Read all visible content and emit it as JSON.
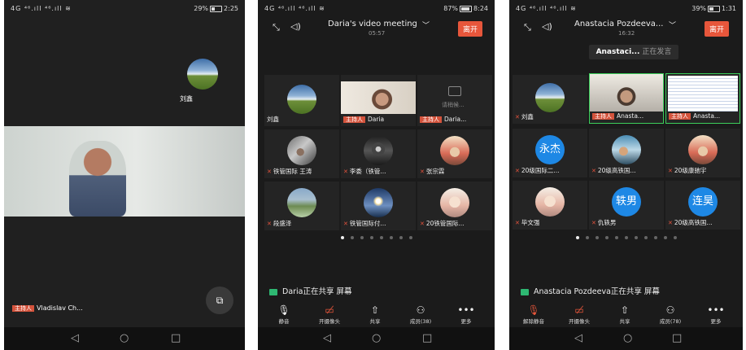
{
  "phone1": {
    "status_left": "4G ⁴⁶.ıll ⁴⁶.ıll ≋",
    "battery": "29%",
    "time": "2:25",
    "avatar_name": "刘鑫",
    "host_badge": "主持人",
    "speaker_name": "Vladislav Ch...",
    "switch_icon": "camera-switch-icon"
  },
  "phone2": {
    "status_left": "4G ⁴⁶.ıll ⁴⁶.ıll ≋",
    "battery": "87%",
    "time": "8:24",
    "meeting_title": "Daria's video meeting",
    "chev": "﹀",
    "timer": "05:57",
    "leave": "离开",
    "tiles": [
      {
        "name": "刘鑫",
        "host": "",
        "mic_muted": false
      },
      {
        "name": "Daria",
        "host": "主持人",
        "mic_muted": false
      },
      {
        "name": "Daria...",
        "host": "主持人",
        "mic_muted": false,
        "sub": "请稍候..."
      },
      {
        "name": "铁管国际 王涛",
        "host": "",
        "mic_muted": true
      },
      {
        "name": "李委（铁管...",
        "host": "",
        "mic_muted": true
      },
      {
        "name": "张宗霖",
        "host": "",
        "mic_muted": true
      },
      {
        "name": "段盛泽",
        "host": "",
        "mic_muted": true
      },
      {
        "name": "铁管国际付...",
        "host": "",
        "mic_muted": true
      },
      {
        "name": "20铁管国际...",
        "host": "",
        "mic_muted": true
      }
    ],
    "share_text": "Daria正在共享 屏幕",
    "toolbar": [
      {
        "icon": "microphone-icon",
        "label": "静音"
      },
      {
        "icon": "camera-off-icon",
        "label": "开摄像头"
      },
      {
        "icon": "share-screen-icon",
        "label": "共享"
      },
      {
        "icon": "members-icon",
        "label": "成员(38)"
      },
      {
        "icon": "more-icon",
        "label": "更多"
      }
    ]
  },
  "phone3": {
    "status_left": "4G ⁴⁶.ıll ⁴⁶.ıll ≋",
    "battery": "39%",
    "time": "1:31",
    "meeting_title": "Anastacia Pozdeeva...",
    "chev": "﹀",
    "timer": "16:32",
    "leave": "离开",
    "speaking_name": "Anastaci...",
    "speaking_suffix": "正在发言",
    "tiles": [
      {
        "name": "刘鑫",
        "host": "",
        "mic_muted": true
      },
      {
        "name": "Anasta...",
        "host": "主持人",
        "mic_muted": false
      },
      {
        "name": "Anasta...",
        "host": "主持人",
        "mic_muted": false
      },
      {
        "name": "20级国际二...",
        "host": "",
        "mic_muted": true,
        "letter": "永杰"
      },
      {
        "name": "20级高铁国...",
        "host": "",
        "mic_muted": true
      },
      {
        "name": "20级康驰宇",
        "host": "",
        "mic_muted": true
      },
      {
        "name": "毕文强",
        "host": "",
        "mic_muted": true
      },
      {
        "name": "仇轶男",
        "host": "",
        "mic_muted": true,
        "letter": "轶男"
      },
      {
        "name": "20级高铁国...",
        "host": "",
        "mic_muted": true,
        "letter": "连昊"
      }
    ],
    "share_text": "Anastacia Pozdeeva正在共享 屏幕",
    "toolbar": [
      {
        "icon": "microphone-muted-icon",
        "label": "解除静音"
      },
      {
        "icon": "camera-off-icon",
        "label": "开摄像头"
      },
      {
        "icon": "share-screen-icon",
        "label": "共享"
      },
      {
        "icon": "members-icon",
        "label": "成员(78)"
      },
      {
        "icon": "more-icon",
        "label": "更多"
      }
    ]
  },
  "nav": {
    "back": "◁",
    "home": "○",
    "recent": "□"
  },
  "colors": {
    "accent": "#e7563b",
    "share_green": "#2eb872",
    "avatar_blue": "#1e88e5",
    "active_border": "#3ccf5b"
  }
}
